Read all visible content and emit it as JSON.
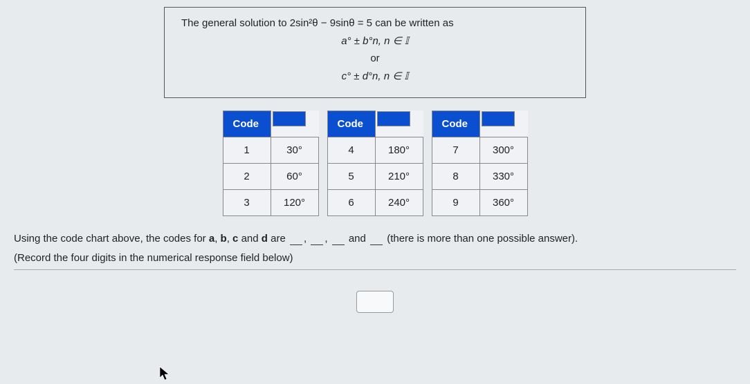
{
  "question": {
    "intro_before": "The general solution to ",
    "equation": "2sin²θ − 9sinθ = 5",
    "intro_after": " can be written as",
    "formula1": "a° ± b°n, n ∈ 𝕀",
    "or_text": "or",
    "formula2": "c° ± d°n, n ∈ 𝕀"
  },
  "code_header": "Code",
  "code_tables": [
    [
      {
        "code": "1",
        "value": "30°"
      },
      {
        "code": "2",
        "value": "60°"
      },
      {
        "code": "3",
        "value": "120°"
      }
    ],
    [
      {
        "code": "4",
        "value": "180°"
      },
      {
        "code": "5",
        "value": "210°"
      },
      {
        "code": "6",
        "value": "240°"
      }
    ],
    [
      {
        "code": "7",
        "value": "300°"
      },
      {
        "code": "8",
        "value": "330°"
      },
      {
        "code": "9",
        "value": "360°"
      }
    ]
  ],
  "instruction": {
    "text_before": "Using the code chart above, the codes for ",
    "bold_a": "a",
    "bold_b": "b",
    "bold_c": "c",
    "bold_d": "d",
    "sep_comma": ", ",
    "and_word": " and ",
    "are_word": " are ",
    "and_between": " and ",
    "paren_note": " (there is more than one possible answer).",
    "record_note": "(Record the four digits in the numerical response field below)"
  }
}
